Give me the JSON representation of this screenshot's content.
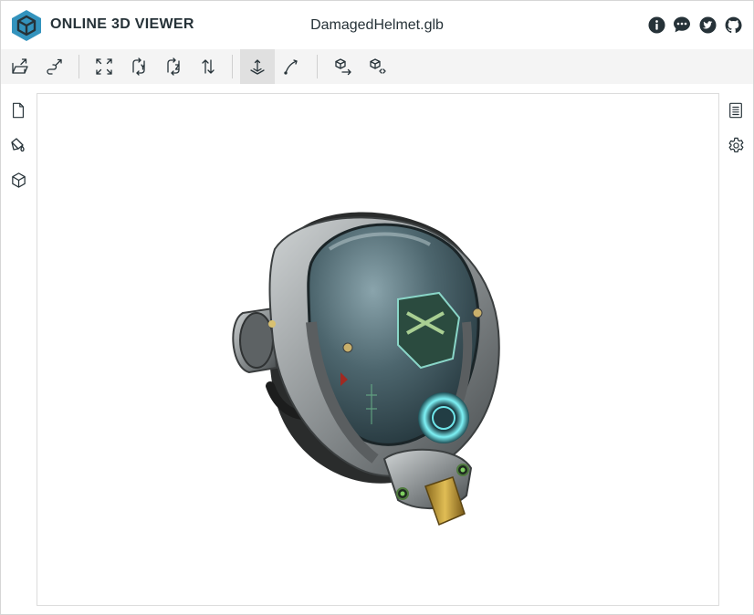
{
  "app": {
    "title": "ONLINE 3D VIEWER",
    "file_name": "DamagedHelmet.glb"
  },
  "colors": {
    "accent": "#3393bd",
    "icon": "#263238",
    "toolbar_bg": "#f4f4f4",
    "active_bg": "#e0e0e0"
  },
  "header_icons": [
    {
      "name": "info-icon"
    },
    {
      "name": "chat-icon"
    },
    {
      "name": "twitter-icon"
    },
    {
      "name": "github-icon"
    }
  ],
  "toolbar": {
    "items": [
      {
        "name": "open-file-icon"
      },
      {
        "name": "open-url-icon"
      },
      {
        "name": "fit-to-window-icon"
      },
      {
        "name": "up-y-icon"
      },
      {
        "name": "up-z-icon"
      },
      {
        "name": "flip-up-icon"
      },
      {
        "name": "fixed-up-vector-icon",
        "active": true
      },
      {
        "name": "free-orbit-icon"
      },
      {
        "name": "export-icon"
      },
      {
        "name": "share-icon"
      }
    ]
  },
  "left_sidebar": [
    {
      "name": "files-icon"
    },
    {
      "name": "materials-icon"
    },
    {
      "name": "meshes-icon"
    }
  ],
  "right_sidebar": [
    {
      "name": "details-icon"
    },
    {
      "name": "settings-icon"
    }
  ]
}
